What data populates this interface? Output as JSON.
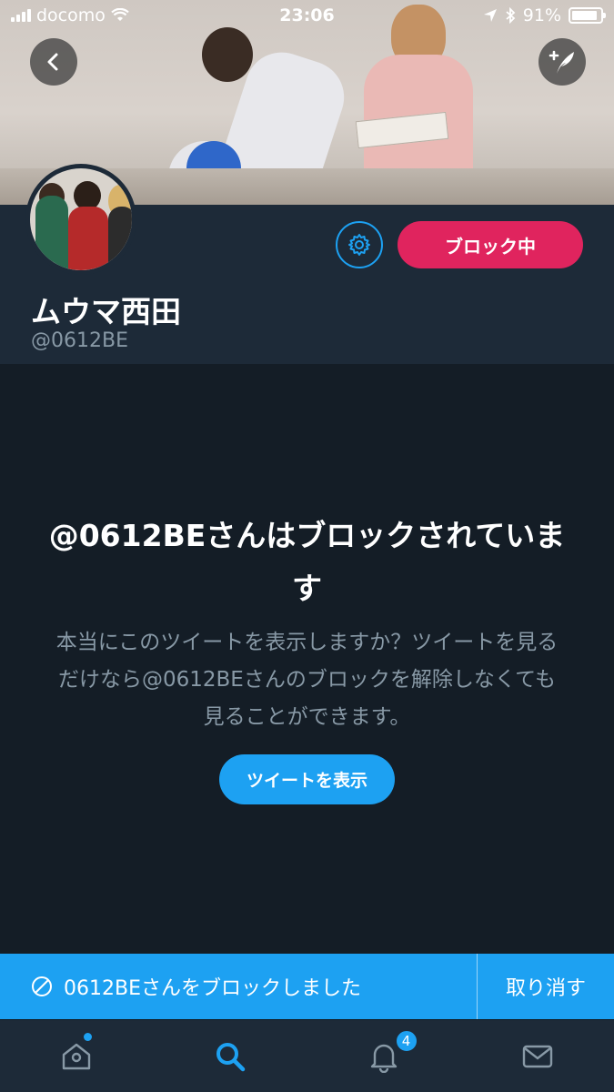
{
  "status_bar": {
    "carrier": "docomo",
    "time": "23:06",
    "battery_percent": "91%",
    "battery_level": 0.91
  },
  "header": {
    "back_icon": "chevron-left-icon",
    "compose_icon": "compose-tweet-icon"
  },
  "profile": {
    "display_name": "ムウマ西田",
    "handle": "@0612BE",
    "settings_icon": "gear-icon",
    "block_button_label": "ブロック中",
    "block_button_color": "#e0245e"
  },
  "block_notice": {
    "title": "@0612BEさんはブロックされています",
    "body": "本当にこのツイートを表示しますか？ツイートを見るだけなら@0612BEさんのブロックを解除しなくても見ることができます。",
    "show_tweets_label": "ツイートを表示"
  },
  "toast": {
    "icon": "block-icon",
    "message": "0612BEさんをブロックしました",
    "undo_label": "取り消す"
  },
  "tabbar": {
    "items": [
      {
        "icon": "home-icon",
        "has_dot": true
      },
      {
        "icon": "search-icon",
        "active": true
      },
      {
        "icon": "notifications-icon",
        "badge": "4"
      },
      {
        "icon": "messages-icon"
      }
    ]
  },
  "colors": {
    "accent": "#1da1f2",
    "background": "#141d26",
    "header_bg": "#1d2a38",
    "muted_text": "#8899a6"
  }
}
